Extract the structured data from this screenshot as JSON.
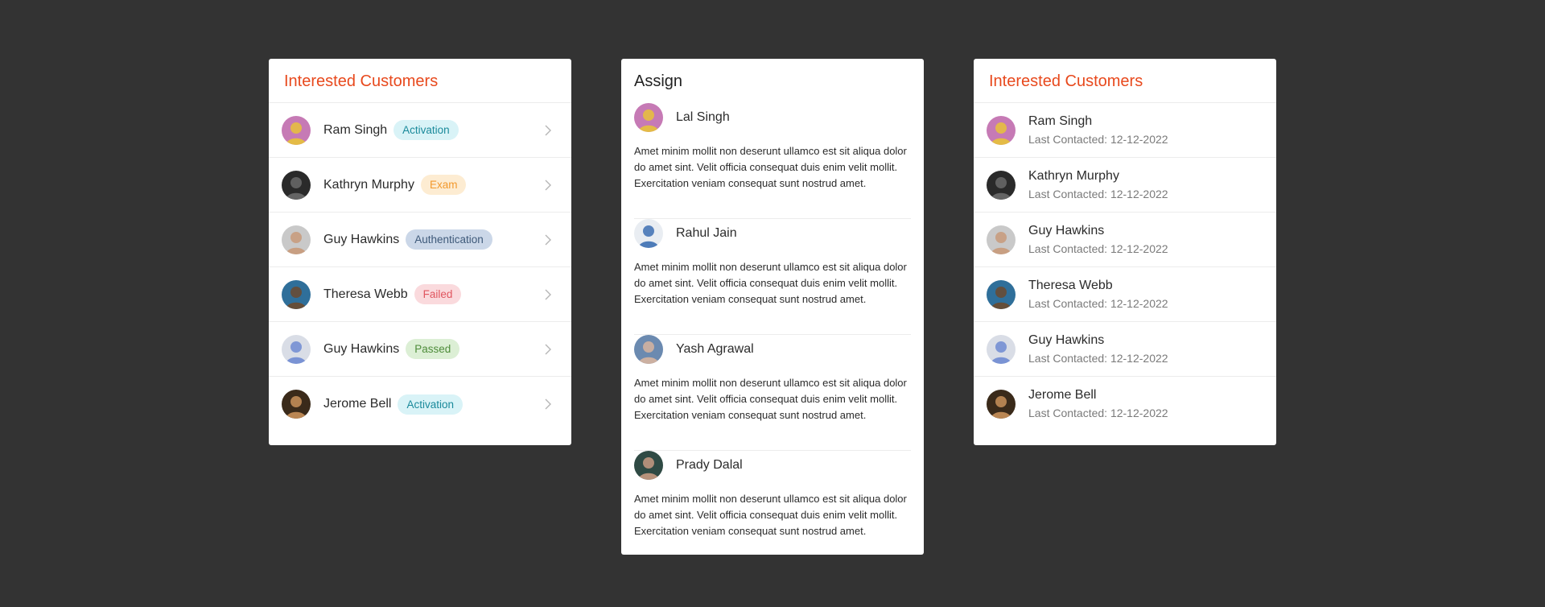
{
  "left_card": {
    "title": "Interested Customers",
    "rows": [
      {
        "name": "Ram Singh",
        "badge": "Activation",
        "badge_bg": "#d9f3f7",
        "badge_fg": "#1a8a9b",
        "avatar_bg": "#c67ab5",
        "avatar_fg": "#e7c23a"
      },
      {
        "name": "Kathryn Murphy",
        "badge": "Exam",
        "badge_bg": "#fdecd2",
        "badge_fg": "#f2992e",
        "avatar_bg": "#2a2a2a",
        "avatar_fg": "#6a6a6a"
      },
      {
        "name": "Guy Hawkins",
        "badge": "Authentication",
        "badge_bg": "#cbd7e8",
        "badge_fg": "#3f5a7a",
        "avatar_bg": "#c9c9c9",
        "avatar_fg": "#c89a7a"
      },
      {
        "name": "Theresa Webb",
        "badge": "Failed",
        "badge_bg": "#fadadd",
        "badge_fg": "#e0565f",
        "avatar_bg": "#2f6f9a",
        "avatar_fg": "#6b4a2f"
      },
      {
        "name": "Guy Hawkins",
        "badge": "Passed",
        "badge_bg": "#dcefd5",
        "badge_fg": "#4e8c3a",
        "avatar_bg": "#d9dde6",
        "avatar_fg": "#6f8bd1"
      },
      {
        "name": "Jerome Bell",
        "badge": "Activation",
        "badge_bg": "#d9f3f7",
        "badge_fg": "#1a8a9b",
        "avatar_bg": "#3a2a1a",
        "avatar_fg": "#c9905a"
      }
    ]
  },
  "mid_card": {
    "title": "Assign",
    "items": [
      {
        "name": "Lal Singh",
        "text": "Amet minim mollit non deserunt ullamco est sit aliqua dolor do amet sint. Velit officia consequat duis enim velit mollit. Exercitation veniam consequat sunt nostrud amet.",
        "avatar_bg": "#c67ab5",
        "avatar_fg": "#e7c23a"
      },
      {
        "name": "Rahul Jain",
        "text": "Amet minim mollit non deserunt ullamco est sit aliqua dolor do amet sint. Velit officia consequat duis enim velit mollit. Exercitation veniam consequat sunt nostrud amet.",
        "avatar_bg": "#e9edf2",
        "avatar_fg": "#3d6fb3"
      },
      {
        "name": "Yash Agrawal",
        "text": "Amet minim mollit non deserunt ullamco est sit aliqua dolor do amet sint. Velit officia consequat duis enim velit mollit. Exercitation veniam consequat sunt nostrud amet.",
        "avatar_bg": "#6b8ab0",
        "avatar_fg": "#d7b4a0"
      },
      {
        "name": "Prady Dalal",
        "text": "Amet minim mollit non deserunt ullamco est sit aliqua dolor do amet sint. Velit officia consequat duis enim velit mollit. Exercitation veniam consequat sunt nostrud amet.",
        "avatar_bg": "#2f4a44",
        "avatar_fg": "#c79a82"
      }
    ]
  },
  "right_card": {
    "title": "Interested Customers",
    "rows": [
      {
        "name": "Ram Singh",
        "sub": "Last Contacted: 12-12-2022",
        "avatar_bg": "#c67ab5",
        "avatar_fg": "#e7c23a"
      },
      {
        "name": "Kathryn Murphy",
        "sub": "Last Contacted: 12-12-2022",
        "avatar_bg": "#2a2a2a",
        "avatar_fg": "#6a6a6a"
      },
      {
        "name": "Guy Hawkins",
        "sub": "Last Contacted: 12-12-2022",
        "avatar_bg": "#c9c9c9",
        "avatar_fg": "#c89a7a"
      },
      {
        "name": "Theresa Webb",
        "sub": "Last Contacted: 12-12-2022",
        "avatar_bg": "#2f6f9a",
        "avatar_fg": "#6b4a2f"
      },
      {
        "name": "Guy Hawkins",
        "sub": "Last Contacted: 12-12-2022",
        "avatar_bg": "#d9dde6",
        "avatar_fg": "#6f8bd1"
      },
      {
        "name": "Jerome Bell",
        "sub": "Last Contacted: 12-12-2022",
        "avatar_bg": "#3a2a1a",
        "avatar_fg": "#c9905a"
      }
    ]
  },
  "colors": {
    "page_bg": "#333333",
    "accent": "#e8491d",
    "card_bg": "#ffffff",
    "divider": "#ececec"
  },
  "icons": {
    "row_chevron": "chevron-right-icon"
  }
}
